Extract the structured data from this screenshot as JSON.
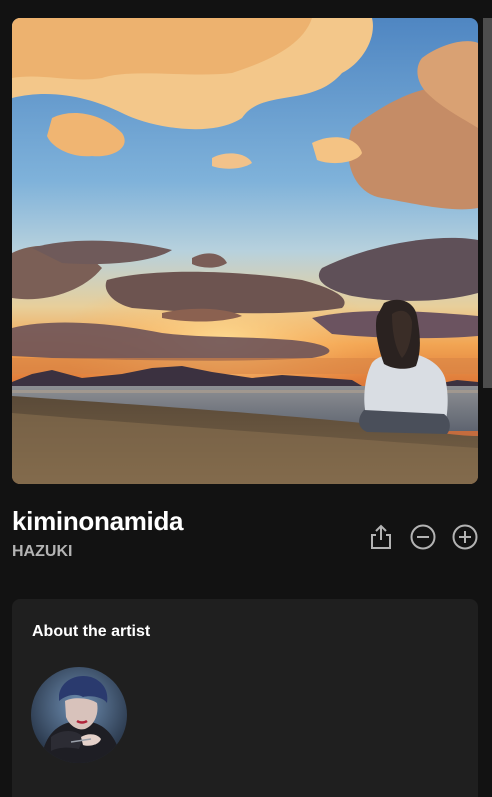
{
  "track": {
    "title": "kiminonamida",
    "artist": "HAZUKI"
  },
  "actions": {
    "share_icon": "share-icon",
    "remove_icon": "minus-circle-icon",
    "add_icon": "plus-circle-icon"
  },
  "about": {
    "heading": "About the artist"
  },
  "colors": {
    "background": "#121212",
    "card": "#1f1f1f",
    "text_primary": "#ffffff",
    "text_secondary": "#b3b3b3"
  }
}
